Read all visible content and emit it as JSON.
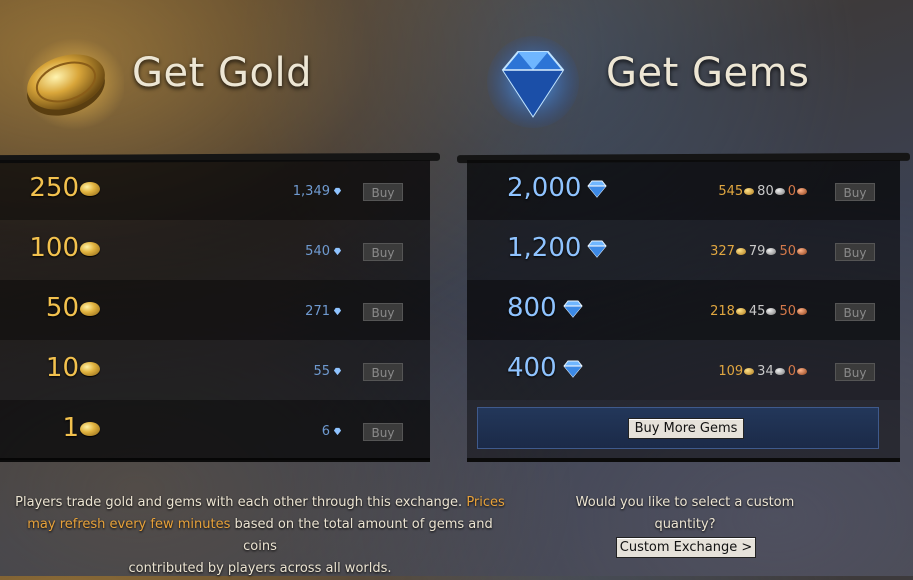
{
  "gold": {
    "title": "Get Gold",
    "icon": "gold-coin-icon",
    "rows": [
      {
        "amount": "250",
        "price": "1,349",
        "buy": "Buy"
      },
      {
        "amount": "100",
        "price": "540",
        "buy": "Buy"
      },
      {
        "amount": "50",
        "price": "271",
        "buy": "Buy"
      },
      {
        "amount": "10",
        "price": "55",
        "buy": "Buy"
      },
      {
        "amount": "1",
        "price": "6",
        "buy": "Buy"
      }
    ]
  },
  "gems": {
    "title": "Get Gems",
    "icon": "gem-icon",
    "rows": [
      {
        "amount": "2,000",
        "gold": "545",
        "silver": "80",
        "copper": "0",
        "buy": "Buy"
      },
      {
        "amount": "1,200",
        "gold": "327",
        "silver": "79",
        "copper": "50",
        "buy": "Buy"
      },
      {
        "amount": "800",
        "gold": "218",
        "silver": "45",
        "copper": "50",
        "buy": "Buy"
      },
      {
        "amount": "400",
        "gold": "109",
        "silver": "34",
        "copper": "0",
        "buy": "Buy"
      }
    ],
    "buy_more_label": "Buy More Gems"
  },
  "footer": {
    "info_part1": "Players trade gold and gems with each other through this exchange. ",
    "info_highlight_a": "Prices",
    "info_highlight_b": "may refresh every few minutes",
    "info_part2": " based on the total amount of gems and coins",
    "info_part3": "contributed by players across all worlds.",
    "custom_question_1": "Would you like to select a custom",
    "custom_question_2": "quantity?",
    "custom_exchange_label": "Custom Exchange >"
  },
  "colors": {
    "gold_text": "#f2c14e",
    "gem_text": "#8fc3ff",
    "highlight": "#e8a23a"
  }
}
